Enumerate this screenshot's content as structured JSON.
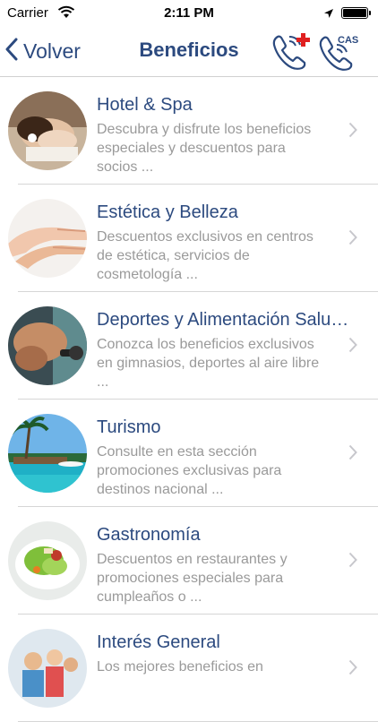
{
  "status": {
    "carrier": "Carrier",
    "time": "2:11 PM"
  },
  "nav": {
    "back_label": "Volver",
    "title": "Beneficios",
    "cas_label": "CAS"
  },
  "items": [
    {
      "title": "Hotel & Spa",
      "description": "Descubra y disfrute los beneficios especiales y descuentos para socios ..."
    },
    {
      "title": "Estética y Belleza",
      "description": "Descuentos exclusivos en centros de estética, servicios de cosmetología ..."
    },
    {
      "title": "Deportes y Alimentación Saludable",
      "description": "Conozca los beneficios exclusivos en gimnasios, deportes al aire libre ..."
    },
    {
      "title": "Turismo",
      "description": "Consulte en esta sección promociones exclusivas para destinos nacional ..."
    },
    {
      "title": "Gastronomía",
      "description": "Descuentos en restaurantes y promociones especiales para cumpleaños o ..."
    },
    {
      "title": "Interés General",
      "description": "Los mejores beneficios en"
    }
  ],
  "colors": {
    "accent": "#2c4a7f",
    "secondary_text": "#9a9a9a",
    "red_plus": "#e02020"
  }
}
